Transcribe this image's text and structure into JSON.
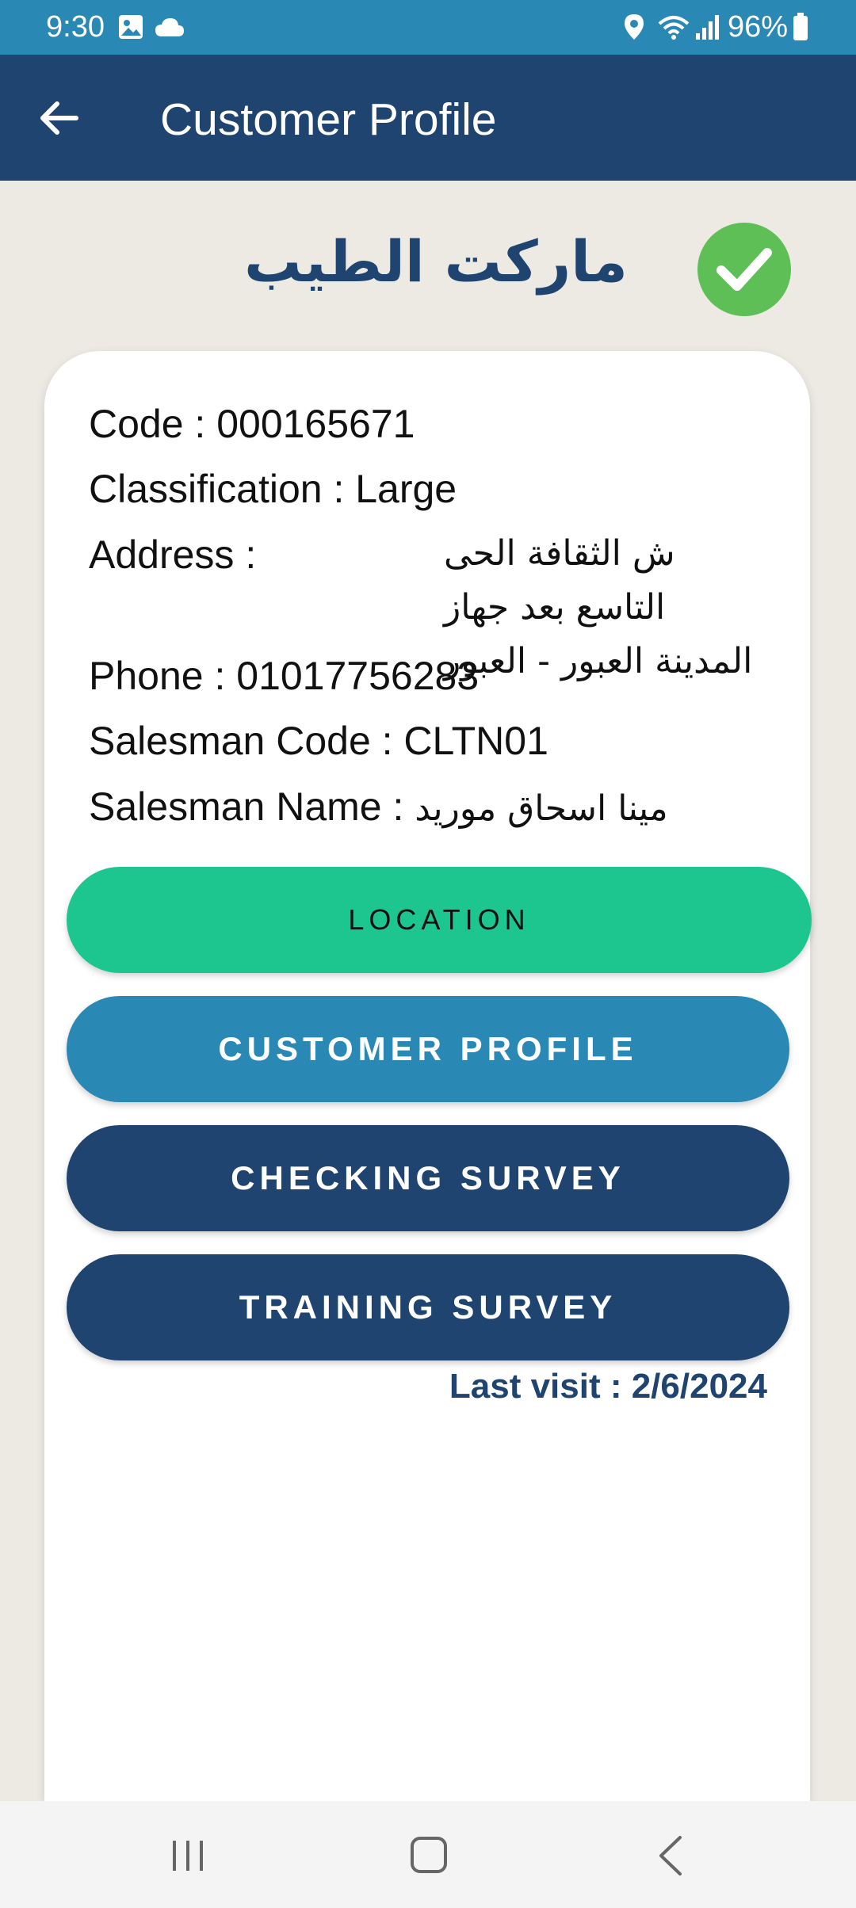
{
  "status_bar": {
    "time": "9:30",
    "battery": "96%",
    "icons": [
      "image-icon",
      "cloud-icon",
      "location-icon",
      "wifi-icon",
      "signal-icon",
      "battery-icon"
    ]
  },
  "app_bar": {
    "title": "Customer Profile",
    "back_icon": "arrow-left-icon"
  },
  "store": {
    "name": "ماركت الطيب",
    "verified_icon": "check-circle-icon"
  },
  "details": {
    "code": "Code : 000165671",
    "classification": "Classification : Large",
    "address_label": "Address :",
    "address_value": "ش الثقافة الحى التاسع بعد جهاز المدينة العبور - العبور",
    "phone": "Phone : 01017756283",
    "salesman_code": "Salesman Code : CLTN01",
    "salesman_name_label": "Salesman Name :",
    "salesman_name_value": "مينا اسحاق موريد"
  },
  "buttons": {
    "location": "LOCATION",
    "customer_profile": "CUSTOMER PROFILE",
    "checking_survey": "CHECKING SURVEY",
    "training_survey": "TRAINING SURVEY"
  },
  "last_visit": "Last visit : 2/6/2024",
  "colors": {
    "status_bar": "#2a89b4",
    "app_bar": "#1f4470",
    "location_button": "#1ec68f",
    "profile_button": "#2a89b4",
    "survey_button": "#1f4470",
    "verified": "#5fbf57"
  },
  "nav_bar": {
    "icons": [
      "recents-icon",
      "home-icon",
      "back-icon"
    ]
  }
}
